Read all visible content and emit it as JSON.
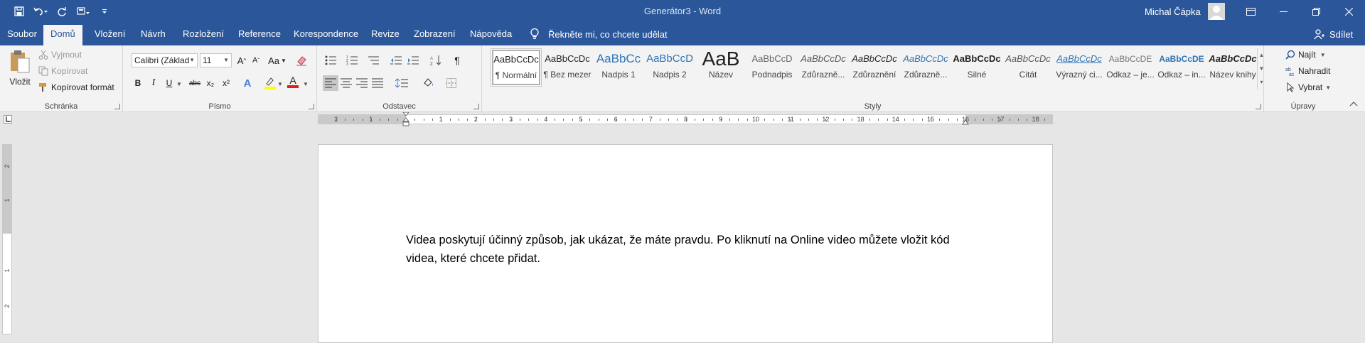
{
  "window": {
    "title": "Generátor3  -  Word",
    "user_name": "Michal Čápka"
  },
  "tabs": [
    {
      "label": "Soubor"
    },
    {
      "label": "Domů"
    },
    {
      "label": "Vložení"
    },
    {
      "label": "Návrh"
    },
    {
      "label": "Rozložení"
    },
    {
      "label": "Reference"
    },
    {
      "label": "Korespondence"
    },
    {
      "label": "Revize"
    },
    {
      "label": "Zobrazení"
    },
    {
      "label": "Nápověda"
    }
  ],
  "tell_me": "Řekněte mi, co chcete udělat",
  "share": "Sdílet",
  "clipboard": {
    "label": "Schránka",
    "paste": "Vložit",
    "cut": "Vyjmout",
    "copy": "Kopírovat",
    "format_painter": "Kopírovat formát"
  },
  "font": {
    "label": "Písmo",
    "font_name": "Calibri (Základ",
    "font_size": "11",
    "change_case": "Aa",
    "bold": "B",
    "italic": "I",
    "underline": "U",
    "strike": "abc",
    "subscript": "x₂",
    "superscript": "x²",
    "text_effects": "A",
    "font_color": "A"
  },
  "paragraph": {
    "label": "Odstavec"
  },
  "styles": {
    "label": "Styly",
    "items": [
      {
        "preview": "AaBbCcDc",
        "name": "¶ Normální"
      },
      {
        "preview": "AaBbCcDc",
        "name": "¶ Bez mezer"
      },
      {
        "preview": "AaBbCc",
        "name": "Nadpis 1"
      },
      {
        "preview": "AaBbCcD",
        "name": "Nadpis 2"
      },
      {
        "preview": "AaB",
        "name": "Název"
      },
      {
        "preview": "AaBbCcD",
        "name": "Podnadpis"
      },
      {
        "preview": "AaBbCcDc",
        "name": "Zdůrazně..."
      },
      {
        "preview": "AaBbCcDc",
        "name": "Zdůraznění"
      },
      {
        "preview": "AaBbCcDc",
        "name": "Zdůrazně..."
      },
      {
        "preview": "AaBbCcDc",
        "name": "Silné"
      },
      {
        "preview": "AaBbCcDc",
        "name": "Citát"
      },
      {
        "preview": "AaBbCcDc",
        "name": "Výrazný ci..."
      },
      {
        "preview": "AaBbCcDE",
        "name": "Odkaz – je..."
      },
      {
        "preview": "AaBbCcDE",
        "name": "Odkaz – in..."
      },
      {
        "preview": "AaBbCcDc",
        "name": "Název knihy"
      }
    ]
  },
  "editing": {
    "label": "Úpravy",
    "find": "Najít",
    "replace": "Nahradit",
    "select": "Vybrat"
  },
  "ruler": {
    "labels": [
      "2",
      "1",
      "1",
      "2",
      "3",
      "4",
      "5",
      "6",
      "7",
      "8",
      "9",
      "10",
      "11",
      "12",
      "13",
      "14",
      "15",
      "16",
      "17",
      "18"
    ],
    "vertical_labels": [
      "2",
      "1",
      "1",
      "2"
    ]
  },
  "document": {
    "paragraph": "Videa poskytují účinný způsob, jak ukázat, že máte pravdu. Po kliknutí na Online video můžete vložit kód videa, které chcete přidat."
  },
  "colors": {
    "accent": "#2b579a",
    "ribbon_bg": "#f3f3f3",
    "canvas_bg": "#e6e6e6"
  }
}
